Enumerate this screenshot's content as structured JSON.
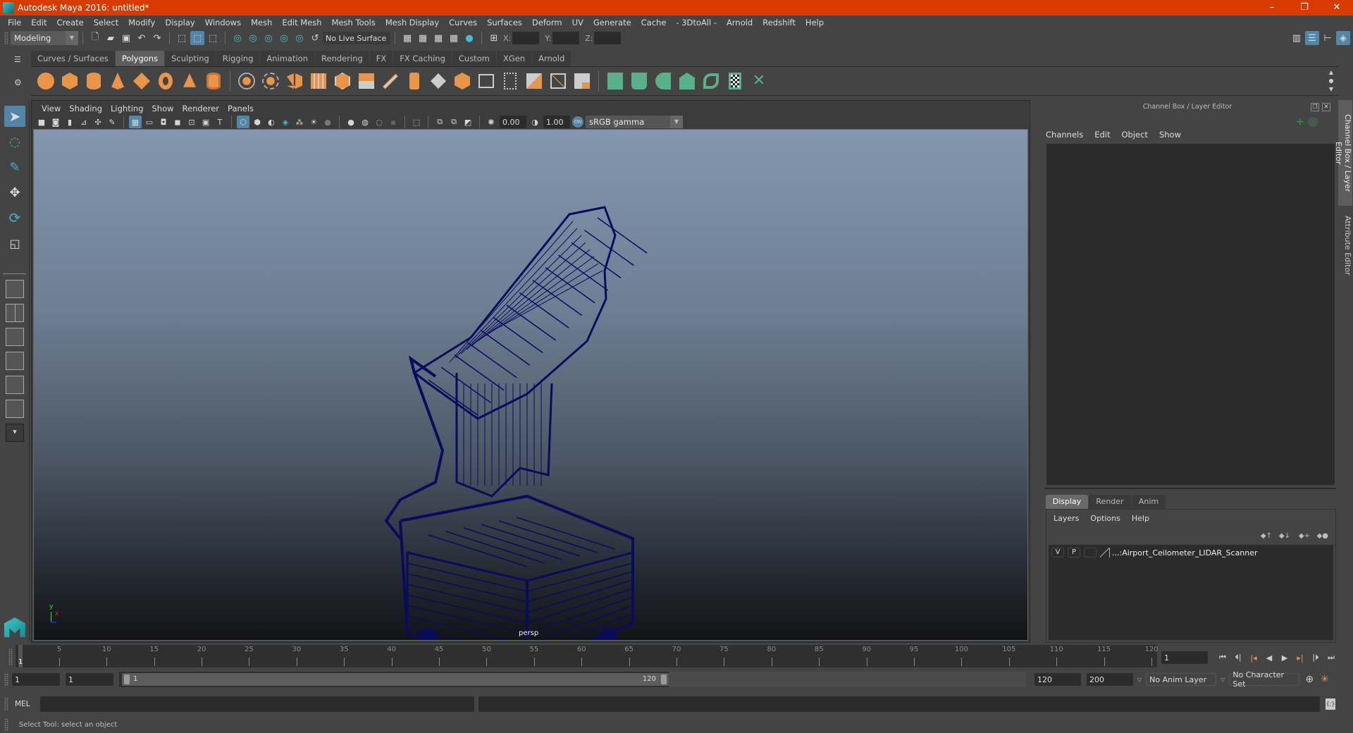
{
  "window": {
    "title": "Autodesk Maya 2016: untitled*",
    "controls": [
      "–",
      "❐",
      "✕"
    ]
  },
  "menubar": [
    "File",
    "Edit",
    "Create",
    "Select",
    "Modify",
    "Display",
    "Windows",
    "Mesh",
    "Edit Mesh",
    "Mesh Tools",
    "Mesh Display",
    "Curves",
    "Surfaces",
    "Deform",
    "UV",
    "Generate",
    "Cache",
    "- 3DtoAll -",
    "Arnold",
    "Redshift",
    "Help"
  ],
  "statusline": {
    "mode": "Modeling",
    "live_surface": "No Live Surface",
    "x_label": "X:",
    "y_label": "Y:",
    "z_label": "Z:",
    "x_value": "",
    "y_value": "",
    "z_value": ""
  },
  "shelf": {
    "tabs": [
      "Curves / Surfaces",
      "Polygons",
      "Sculpting",
      "Rigging",
      "Animation",
      "Rendering",
      "FX",
      "FX Caching",
      "Custom",
      "XGen",
      "Arnold"
    ],
    "active_tab": "Polygons",
    "icons": [
      "poly-sphere-icon",
      "poly-cube-icon",
      "poly-cylinder-icon",
      "poly-cone-icon",
      "poly-plane-icon",
      "poly-torus-icon",
      "poly-pyramid-icon",
      "poly-pipe-icon",
      "combine-icon",
      "separate-icon",
      "mirror-icon",
      "smooth-icon",
      "bevel-icon",
      "bridge-icon",
      "extrude-icon",
      "multi-cut-icon",
      "insert-edge-loop-icon",
      "merge-icon",
      "bevel-face-icon",
      "append-icon",
      "fill-hole-icon",
      "target-weld-icon",
      "planar-uv-icon",
      "automatic-uv-icon",
      "uv-editor-icon",
      "cylindrical-uv-icon",
      "unfold-uv-icon",
      "spherical-uv-icon",
      "uv-shell-icon",
      "cut-uv-icon",
      "sew-uv-icon",
      "layout-uv-icon",
      "texel-density-icon"
    ]
  },
  "viewport": {
    "menu": [
      "View",
      "Shading",
      "Lighting",
      "Show",
      "Renderer",
      "Panels"
    ],
    "exposure": "0.00",
    "gamma": "1.00",
    "color_space": "sRGB gamma",
    "camera_label": "persp",
    "axis_labels": {
      "y": "y",
      "x": "x"
    },
    "wire_color": "#0b0b5e"
  },
  "channelbox": {
    "title": "Channel Box / Layer Editor",
    "menu": [
      "Channels",
      "Edit",
      "Object",
      "Show"
    ]
  },
  "layer_editor": {
    "tabs": [
      "Display",
      "Render",
      "Anim"
    ],
    "active_tab": "Display",
    "menu": [
      "Layers",
      "Options",
      "Help"
    ],
    "layers": [
      {
        "visible": "V",
        "playback": "P",
        "name": "...:Airport_Ceilometer_LIDAR_Scanner"
      }
    ]
  },
  "side_tabs": [
    "Channel Box / Layer Editor",
    "Attribute Editor"
  ],
  "timeline": {
    "ticks": [
      "5",
      "10",
      "15",
      "20",
      "25",
      "30",
      "35",
      "40",
      "45",
      "50",
      "55",
      "60",
      "65",
      "70",
      "75",
      "80",
      "85",
      "90",
      "95",
      "100",
      "105",
      "110",
      "115",
      "120"
    ],
    "start": 1,
    "end": 120,
    "current_frame_marker": "1",
    "current_frame": "1"
  },
  "range": {
    "start_time": "1",
    "playback_start": "1",
    "range_start_label": "1",
    "range_end_label": "120",
    "playback_end": "120",
    "end_time": "200",
    "anim_layer": "No Anim Layer",
    "character_set": "No Character Set"
  },
  "command_line": {
    "label": "MEL",
    "value": "",
    "result": ""
  },
  "help_line": "Select Tool: select an object"
}
